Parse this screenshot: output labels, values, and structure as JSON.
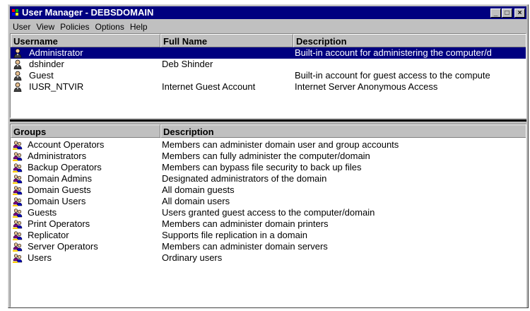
{
  "window": {
    "title": "User Manager - DEBSDOMAIN"
  },
  "menu": [
    "User",
    "View",
    "Policies",
    "Options",
    "Help"
  ],
  "users": {
    "columns": [
      "Username",
      "Full Name",
      "Description"
    ],
    "rows": [
      {
        "username": "Administrator",
        "full_name": "",
        "description": "Built-in account for administering the computer/d",
        "selected": true
      },
      {
        "username": "dshinder",
        "full_name": "Deb Shinder",
        "description": ""
      },
      {
        "username": "Guest",
        "full_name": "",
        "description": "Built-in account for guest access to the compute"
      },
      {
        "username": "IUSR_NTVIR",
        "full_name": "Internet Guest Account",
        "description": "Internet Server Anonymous Access"
      }
    ]
  },
  "groups": {
    "columns": [
      "Groups",
      "Description"
    ],
    "rows": [
      {
        "name": "Account Operators",
        "description": "Members can administer domain user and group accounts"
      },
      {
        "name": "Administrators",
        "description": "Members can fully administer the computer/domain"
      },
      {
        "name": "Backup Operators",
        "description": "Members can bypass file security to back up files"
      },
      {
        "name": "Domain Admins",
        "description": "Designated administrators of the domain"
      },
      {
        "name": "Domain Guests",
        "description": "All domain guests"
      },
      {
        "name": "Domain Users",
        "description": "All domain users"
      },
      {
        "name": "Guests",
        "description": "Users granted guest access to the computer/domain"
      },
      {
        "name": "Print Operators",
        "description": "Members can administer domain printers"
      },
      {
        "name": "Replicator",
        "description": "Supports file replication in a domain"
      },
      {
        "name": "Server Operators",
        "description": "Members can administer domain servers"
      },
      {
        "name": "Users",
        "description": "Ordinary users"
      }
    ]
  },
  "icons": {
    "user": "user-icon",
    "group": "group-icon"
  },
  "colors": {
    "titlebar": "#000080",
    "selection": "#000080",
    "chrome": "#c0c0c0"
  }
}
